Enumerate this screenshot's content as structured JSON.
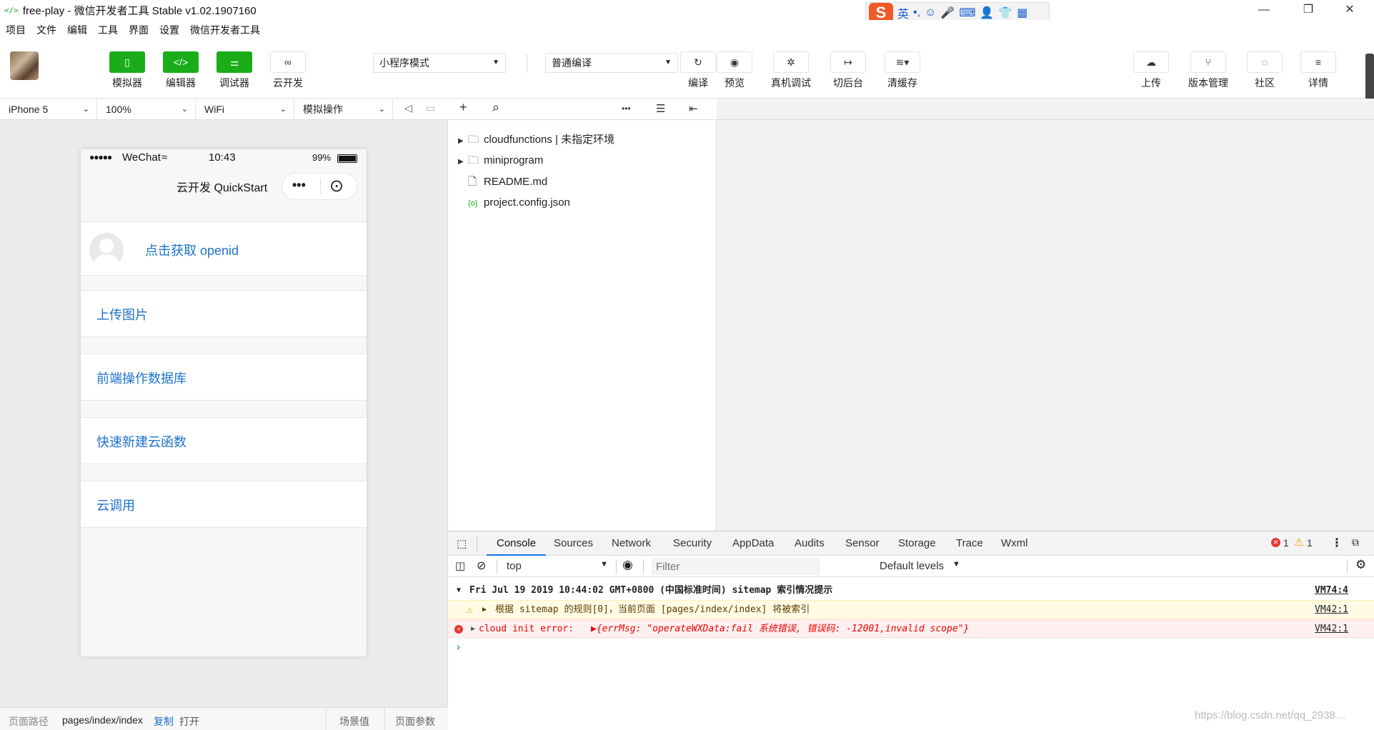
{
  "titlebar": {
    "icon": "</>",
    "title": "free-play - 微信开发者工具 Stable v1.02.1907160"
  },
  "ime": {
    "logo": "S",
    "lang": "英",
    "icons": [
      "•,",
      "☺",
      "🎤",
      "⌨",
      "👤",
      "👕",
      "▦"
    ]
  },
  "window_controls": {
    "minimize": "—",
    "restore": "❐",
    "close": "✕"
  },
  "menu": [
    "项目",
    "文件",
    "编辑",
    "工具",
    "界面",
    "设置",
    "微信开发者工具"
  ],
  "toolbar": {
    "left_buttons": [
      {
        "label": "模拟器",
        "icon": "▯"
      },
      {
        "label": "编辑器",
        "icon": "</>"
      },
      {
        "label": "调试器",
        "icon": "⚌"
      },
      {
        "label": "云开发",
        "icon": "∞"
      }
    ],
    "mode_select": "小程序模式",
    "compile_select": "普通编译",
    "mid_buttons": [
      {
        "label": "编译",
        "icon": "↻"
      },
      {
        "label": "预览",
        "icon": "◉"
      },
      {
        "label": "真机调试",
        "icon": "✲"
      },
      {
        "label": "切后台",
        "icon": "↦"
      },
      {
        "label": "清缓存",
        "icon": "≋▾"
      }
    ],
    "right_buttons": [
      {
        "label": "上传",
        "icon": "☁"
      },
      {
        "label": "版本管理",
        "icon": "⑂"
      },
      {
        "label": "社区",
        "icon": "◌"
      },
      {
        "label": "详情",
        "icon": "≡"
      }
    ]
  },
  "device_bar": {
    "device": "iPhone 5",
    "zoom": "100%",
    "network": "WiFi",
    "operation": "模拟操作",
    "sound_icon": "◁",
    "window_icon": "▭"
  },
  "phone": {
    "status": {
      "signal": "●●●●●",
      "carrier": "WeChat",
      "wifi": "≈",
      "time": "10:43",
      "battery": "99%"
    },
    "nav_title": "云开发 QuickStart",
    "capsule_more": "•••",
    "capsule_close": "⊙",
    "openid_link": "点击获取 openid",
    "menu_links": [
      "上传图片",
      "前端操作数据库",
      "快速新建云函数",
      "云调用"
    ]
  },
  "sim_footer": {
    "path_label": "页面路径",
    "path": "pages/index/index",
    "copy": "复制",
    "open": "打开",
    "scene": "场景值",
    "params": "页面参数"
  },
  "tree_toolbar": {
    "add": "+",
    "search": "⌕",
    "more": "•••",
    "collapse": "☰",
    "split": "⇤"
  },
  "tree": [
    {
      "expand": "▶",
      "icon": "🗀",
      "name": "cloudfunctions | 未指定环境"
    },
    {
      "expand": "▶",
      "icon": "🗀",
      "name": "miniprogram"
    },
    {
      "expand": "",
      "icon": "🗋",
      "name": "README.md"
    },
    {
      "expand": "",
      "icon": "{o}",
      "name": "project.config.json"
    }
  ],
  "devtools": {
    "inspect_icon": "⬚",
    "tabs": [
      "Console",
      "Sources",
      "Network",
      "Security",
      "AppData",
      "Audits",
      "Sensor",
      "Storage",
      "Trace",
      "Wxml"
    ],
    "error_count": "1",
    "warning_count": "1",
    "context": "top",
    "filter_placeholder": "Filter",
    "levels": "Default levels",
    "console": [
      {
        "arrow": "▼",
        "text": "Fri Jul 19 2019 10:44:02 GMT+0800 (中国标准时间) sitemap 索引情况提示",
        "ref": "VM74:4"
      },
      {
        "arrow": "▶",
        "text": "根据 sitemap 的规则[0]，当前页面 [pages/index/index] 将被索引",
        "ref": "VM42:1"
      },
      {
        "arrow": "▶",
        "text": "cloud init error:",
        "detail": "▶{errMsg: \"operateWXData:fail 系统错误, 错误码: -12001,invalid scope\"}",
        "ref": "VM42:1"
      }
    ],
    "prompt": "›"
  },
  "watermark": "https://blog.csdn.net/qq_2938…"
}
